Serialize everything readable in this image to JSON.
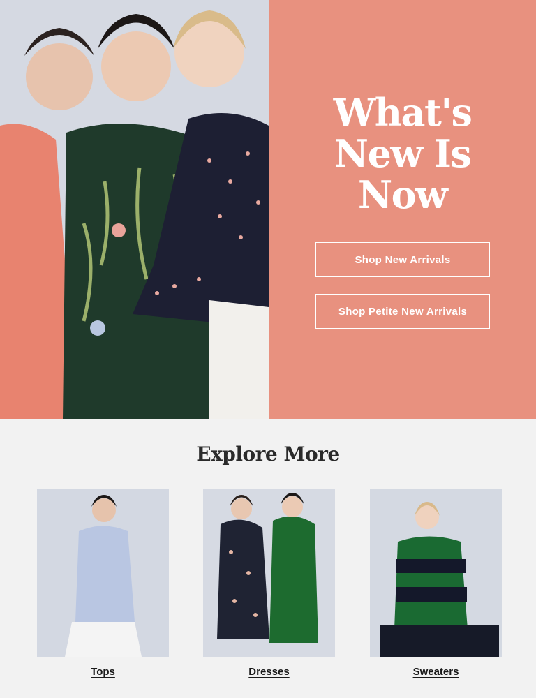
{
  "hero": {
    "headline": [
      "What's",
      "New Is",
      "Now"
    ],
    "primary_cta": "Shop New Arrivals",
    "secondary_cta": "Shop Petite New Arrivals",
    "panel_color": "#e8917f"
  },
  "explore": {
    "title": "Explore More",
    "categories": [
      {
        "label": "Tops"
      },
      {
        "label": "Dresses"
      },
      {
        "label": "Sweaters"
      }
    ]
  }
}
